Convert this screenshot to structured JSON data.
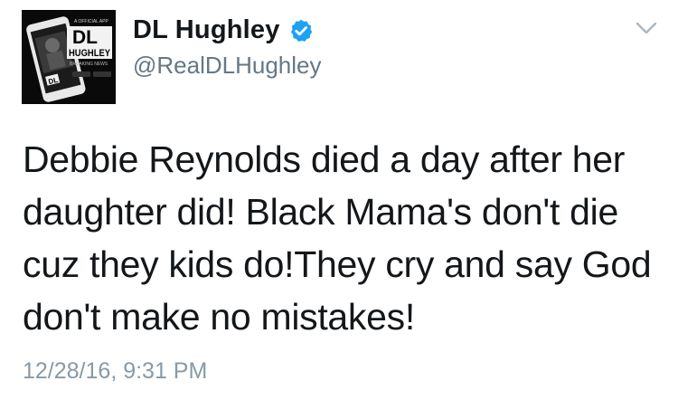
{
  "author": {
    "display_name": "DL Hughley",
    "handle": "@RealDLHughley",
    "verified": true,
    "avatar_text": {
      "top": "A OFFICIAL APP",
      "logo_dl": "DL",
      "logo_name": "HUGHLEY",
      "tagline": "BREAKING NEWS"
    }
  },
  "tweet": {
    "text": "Debbie Reynolds died a day after her\ndaughter did! Black Mama's don't die\ncuz they kids do!They cry and say God\ndon't make no mistakes!",
    "timestamp": "12/28/16, 9:31 PM"
  },
  "icons": {
    "verified": "verified-badge-icon",
    "menu": "chevron-down-icon"
  },
  "colors": {
    "verified_blue": "#1da1f2",
    "text": "#14171a",
    "muted": "#657786",
    "timestamp": "#8899a6"
  }
}
